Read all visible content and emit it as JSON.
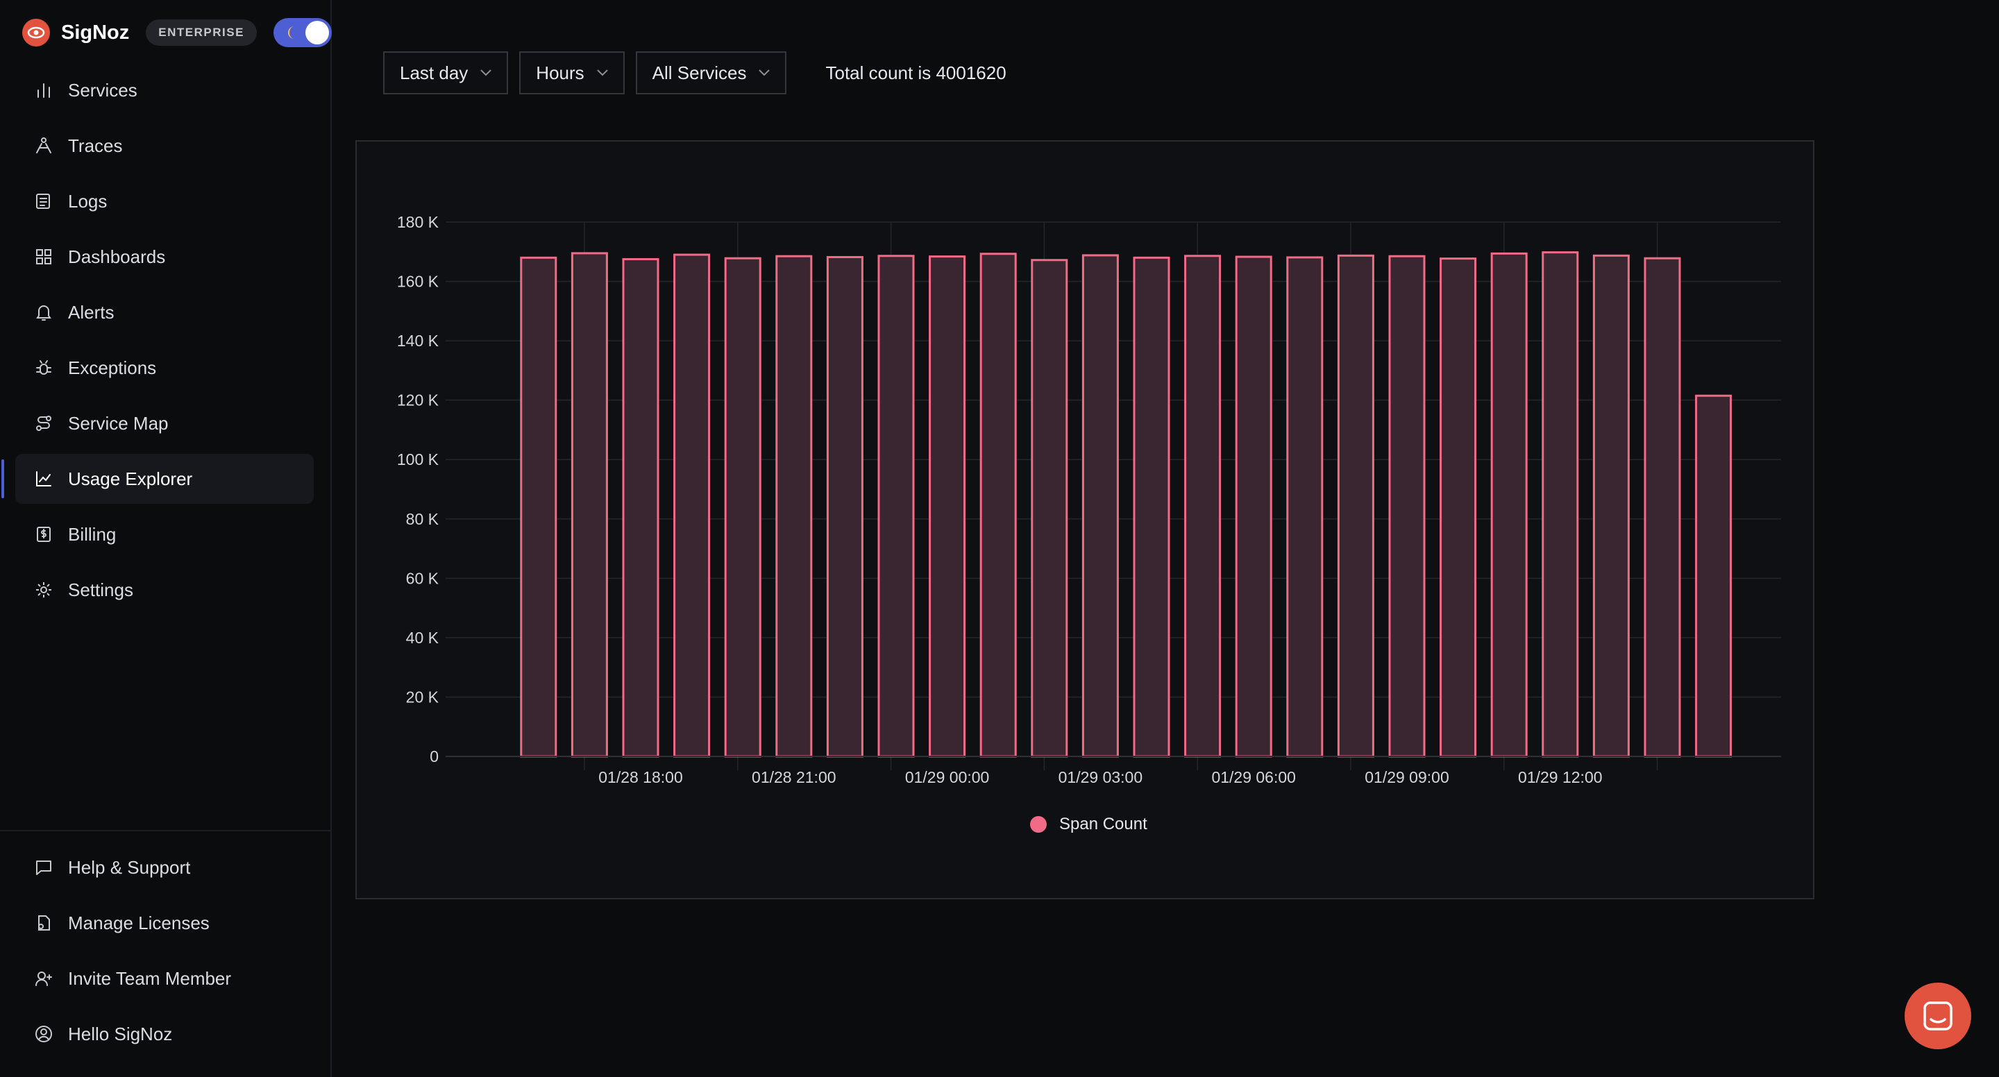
{
  "brand": {
    "name": "SigNoz",
    "badge": "ENTERPRISE"
  },
  "sidebar": {
    "items": [
      {
        "label": "Services",
        "icon": "bar-chart-icon"
      },
      {
        "label": "Traces",
        "icon": "traces-icon"
      },
      {
        "label": "Logs",
        "icon": "logs-icon"
      },
      {
        "label": "Dashboards",
        "icon": "dashboard-grid-icon"
      },
      {
        "label": "Alerts",
        "icon": "bell-icon"
      },
      {
        "label": "Exceptions",
        "icon": "bug-icon"
      },
      {
        "label": "Service Map",
        "icon": "route-icon"
      },
      {
        "label": "Usage Explorer",
        "icon": "line-chart-icon",
        "active": true
      },
      {
        "label": "Billing",
        "icon": "receipt-icon"
      },
      {
        "label": "Settings",
        "icon": "gear-icon"
      }
    ],
    "bottom_items": [
      {
        "label": "Help & Support",
        "icon": "message-icon"
      },
      {
        "label": "Manage Licenses",
        "icon": "license-icon"
      },
      {
        "label": "Invite Team Member",
        "icon": "user-plus-icon"
      },
      {
        "label": "Hello SigNoz",
        "icon": "user-circle-icon"
      }
    ]
  },
  "toolbar": {
    "time_range": "Last day",
    "step": "Hours",
    "service": "All Services",
    "total": "Total count is 4001620"
  },
  "colors": {
    "accent": "#4e5fd6",
    "bar_stroke": "#f26b86",
    "bar_fill": "#3a2630",
    "brand": "#e2533f"
  },
  "chart_data": {
    "type": "bar",
    "series": [
      {
        "name": "Span Count",
        "values": [
          168000,
          169500,
          167500,
          169000,
          167800,
          168500,
          168200,
          168600,
          168400,
          169300,
          167200,
          168800,
          168000,
          168600,
          168300,
          168100,
          168700,
          168500,
          167700,
          169400,
          169800,
          168700,
          167800,
          121500
        ]
      }
    ],
    "x_tick_labels": [
      "01/28 18:00",
      "01/28 21:00",
      "01/29 00:00",
      "01/29 03:00",
      "01/29 06:00",
      "01/29 09:00",
      "01/29 12:00"
    ],
    "y_tick_labels": [
      "0",
      "20 K",
      "40 K",
      "60 K",
      "80 K",
      "100 K",
      "120 K",
      "140 K",
      "160 K",
      "180 K"
    ],
    "ylim": [
      0,
      180000
    ],
    "grid": true,
    "legend": "bottom-center"
  }
}
